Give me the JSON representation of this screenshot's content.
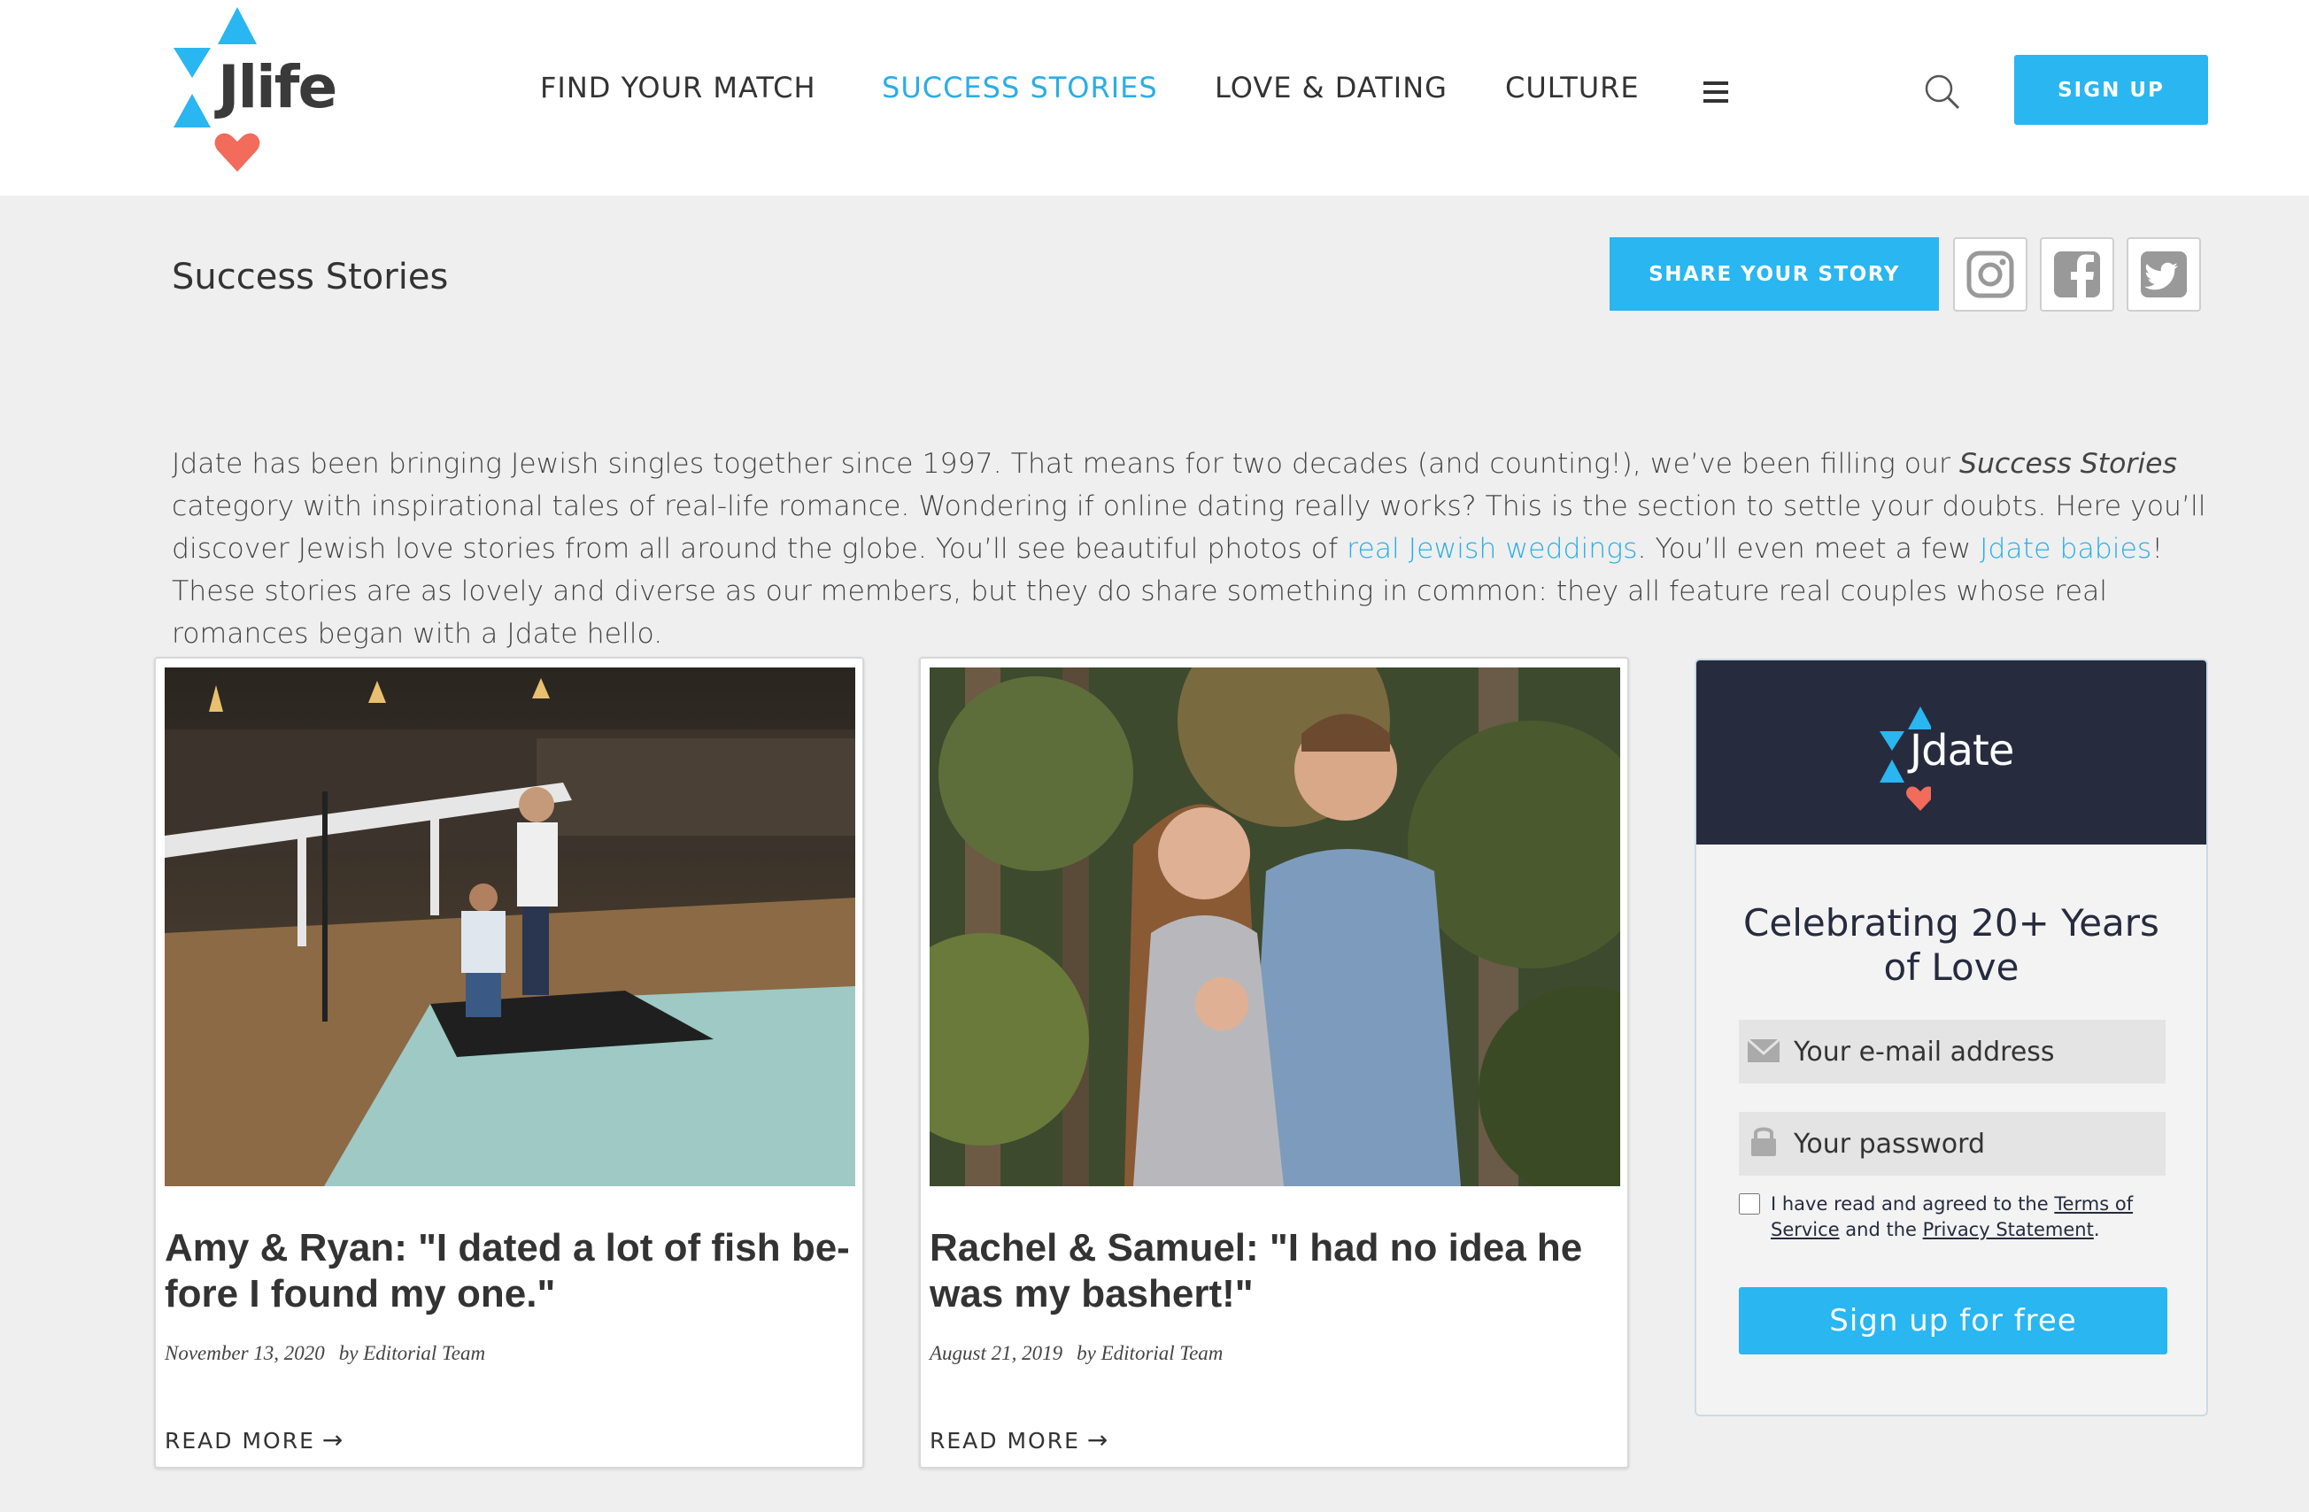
{
  "header": {
    "logo_text": "Jlife",
    "nav": [
      {
        "label": "FIND YOUR MATCH",
        "active": false
      },
      {
        "label": "SUCCESS STORIES",
        "active": true
      },
      {
        "label": "LOVE & DATING",
        "active": false
      },
      {
        "label": "CULTURE",
        "active": false
      }
    ],
    "signup_label": "SIGN UP"
  },
  "page": {
    "title": "Success Stories",
    "share_label": "SHARE YOUR STORY",
    "social": [
      "instagram-icon",
      "facebook-icon",
      "twitter-icon"
    ]
  },
  "intro": {
    "p1": "Jdate has been bringing Jewish singles together since 1997. That means for two decades (and counting!), we’ve been filling our ",
    "em": "Success Stories",
    "p2": " category with inspirational tales of real-life romance. Wondering if online dating really works? This is the section to settle your doubts. Here you’ll discover Jewish love stories from all around the globe. You’ll see beautiful photos of ",
    "link1": "real Jewish weddings",
    "p3": ". You’ll even meet a few ",
    "link2": "Jdate babies",
    "p4": "! These stories are as lovely and diverse as our members, but they do share something in common: they all feature real couples whose real romances began with a Jdate hello."
  },
  "cards": [
    {
      "title": "Amy & Ryan: \"I dated a lot of fish be-fore I found my one.\"",
      "date": "November 13, 2020",
      "by": "by",
      "author": "Editorial Team",
      "read_more": "READ MORE"
    },
    {
      "title": "Rachel & Samuel: \"I had no idea he was my bashert!\"",
      "date": "August 21, 2019",
      "by": "by",
      "author": "Editorial Team",
      "read_more": "READ MORE"
    }
  ],
  "widget": {
    "logo_text": "Jdate",
    "title_line1": "Celebrating 20+ Years",
    "title_line2": "of Love",
    "email_placeholder": "Your e-mail address",
    "password_placeholder": "Your password",
    "terms_prefix": "I have read and agreed to the ",
    "terms_link": "Terms of Service",
    "terms_mid": " and the ",
    "privacy_link": "Privacy Statement",
    "terms_suffix": ".",
    "cta": "Sign up for free"
  },
  "colors": {
    "accent": "#29b6f1",
    "brand_red": "#f26b5b",
    "navy": "#262b3e"
  }
}
